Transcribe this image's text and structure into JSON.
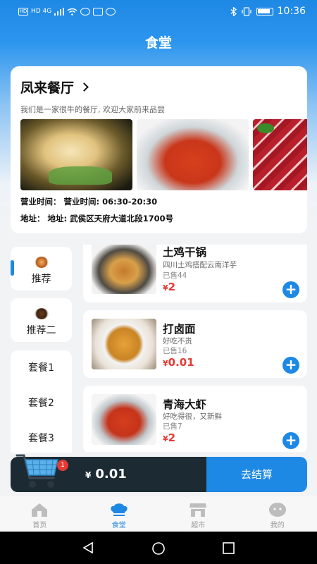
{
  "status_bar": {
    "left_text": "HD 4G",
    "time": "10:36"
  },
  "page": {
    "title": "食堂"
  },
  "shop": {
    "name": "凤来餐厅",
    "description": "我们是一家很牛的餐厅, 欢迎大家前来品尝",
    "hours": "营业时间： 营业时间: 06:30-20:30",
    "address": "地址： 地址: 武侯区天府大道北段1700号"
  },
  "categories": {
    "items": [
      {
        "label": "推荐"
      },
      {
        "label": "推荐二"
      },
      {
        "label": "套餐1"
      },
      {
        "label": "套餐2"
      },
      {
        "label": "套餐3"
      }
    ]
  },
  "dishes": [
    {
      "name": "土鸡干锅",
      "desc": "四川土鸡搭配云南洋芋",
      "sold": "已售44",
      "currency": "¥",
      "price": "2"
    },
    {
      "name": "打卤面",
      "desc": "好吃不贵",
      "sold": "已售16",
      "currency": "¥",
      "price": "0.01"
    },
    {
      "name": "青海大虾",
      "desc": "好吃得很，又新鲜",
      "sold": "已售7",
      "currency": "¥",
      "price": "2"
    }
  ],
  "cart": {
    "count": "1",
    "currency": "¥",
    "total": "0.01",
    "checkout_label": "去结算"
  },
  "bottom_nav": {
    "items": [
      {
        "label": "首页",
        "icon": "home-icon"
      },
      {
        "label": "食堂",
        "icon": "chef-hat-icon"
      },
      {
        "label": "超市",
        "icon": "store-icon"
      },
      {
        "label": "我的",
        "icon": "profile-icon"
      }
    ]
  },
  "colors": {
    "accent": "#1e88e5",
    "price": "#e53935",
    "cart_bar": "#1c2b33"
  }
}
